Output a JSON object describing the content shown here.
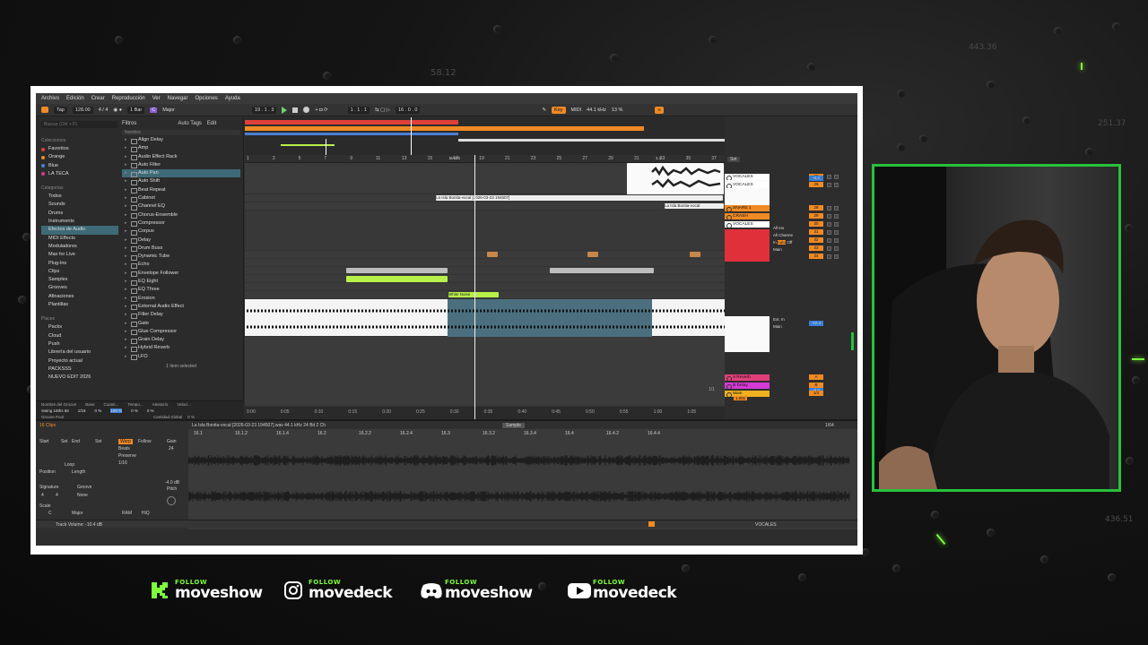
{
  "background_numbers": [
    "58.12",
    "443.36",
    "251.37",
    "436.51"
  ],
  "menu": [
    "Archivo",
    "Edición",
    "Crear",
    "Reproducción",
    "Ver",
    "Navegar",
    "Opciones",
    "Ayuda"
  ],
  "transport": {
    "tap": "Tap",
    "tempo": "128.00",
    "signature": "4 / 4",
    "quant": "1 Bar",
    "key_root": "C",
    "key_scale": "Major",
    "position": "19 . 1 . 3",
    "loop_start": "1 . 1 . 1",
    "loop_length": "16 . 0 . 0",
    "key_label": "Key",
    "midi_label": "MIDI",
    "sample_rate": "44.1 kHz",
    "cpu": "13 %"
  },
  "browser": {
    "search_placeholder": "Buscar (Ctrl + F)",
    "filters_label": "Filtros",
    "autotags_label": "Auto Tags",
    "edit_label": "Edit",
    "name_header": "Nombre",
    "collections_header": "Colecciones",
    "collections": [
      {
        "label": "Favoritos",
        "color": "#e0403a"
      },
      {
        "label": "Orange",
        "color": "#f08a24"
      },
      {
        "label": "Blue",
        "color": "#4a7fd6"
      },
      {
        "label": "LA TECA",
        "color": "#d63a8a"
      }
    ],
    "categories_header": "Categorías",
    "categories": [
      "Todos",
      "Sounds",
      "Drums",
      "Instruments",
      "Efectos de Audio",
      "MIDI Effects",
      "Moduladores",
      "Max for Live",
      "Plug-Ins",
      "Clips",
      "Samples",
      "Grooves",
      "Afinaciones",
      "Plantillas"
    ],
    "places_header": "Places",
    "places": [
      "Packs",
      "Cloud",
      "Push",
      "Librería del usuario",
      "Proyecto actual",
      "PACKSSS",
      "NUEVO EDIT 2026"
    ],
    "devices": [
      "Align Delay",
      "Amp",
      "Audio Effect Rack",
      "Auto Filter",
      "Auto Pan",
      "Auto Shift",
      "Beat Repeat",
      "Cabinet",
      "Channel EQ",
      "Chorus-Ensemble",
      "Compressor",
      "Corpus",
      "Delay",
      "Drum Buss",
      "Dynamic Tube",
      "Echo",
      "Envelope Follower",
      "EQ Eight",
      "EQ Three",
      "Erosion",
      "External Audio Effect",
      "Filter Delay",
      "Gate",
      "Glue Compressor",
      "Grain Delay",
      "Hybrid Reverb",
      "LFO"
    ],
    "selected_info": "1 Item selected",
    "groove_headers": [
      "Nombre del Groove",
      "Base",
      "Cuanti...",
      "Tempo...",
      "Aleatorio",
      "Veloci..."
    ],
    "groove_row": [
      "Swing 16ths 66",
      "1/16",
      "0 %",
      "100 %",
      "0 %",
      "0 %"
    ],
    "groove_pool": "Groove Pool",
    "global_amount": "Cantidad Global",
    "global_value": "0 %"
  },
  "arrangement": {
    "ruler": [
      "1",
      "3",
      "5",
      "7",
      "9",
      "11",
      "13",
      "15",
      "17",
      "19",
      "21",
      "23",
      "25",
      "27",
      "29",
      "31",
      "33",
      "35",
      "37"
    ],
    "locators": [
      "BASS",
      "1.1"
    ],
    "clip_vocal": "La Isla Bonita-vocal [2026-03-23 194507]",
    "clip_vocal_b": "La Isla Bonita-vocal [2026-03-23 194507]",
    "clip_vocal_c": "La Isla Bonita-vocal",
    "clip_white": "White Noise",
    "timeline": [
      "0:00",
      "0:05",
      "0:10",
      "0:15",
      "0:20",
      "0:25",
      "0:30",
      "0:35",
      "0:40",
      "0:45",
      "0:50",
      "0:55",
      "1:00",
      "1:05"
    ],
    "page": "1/1"
  },
  "mixer": {
    "set_label": "Set",
    "tracks": [
      {
        "name": "VOCALES",
        "color": "#ffffff",
        "vol": "25"
      },
      {
        "name": "VOCALES",
        "color": "#ffffff",
        "vol": "26"
      },
      {
        "name": "27 FX chain",
        "color": "#e0403a",
        "vol": ""
      },
      {
        "name": "SNARE 1",
        "color": "#f08a24",
        "vol": "28"
      },
      {
        "name": "CRASH",
        "color": "#f08a24",
        "vol": "29"
      },
      {
        "name": "VOCALES",
        "color": "#ffffff",
        "vol": "30"
      },
      {
        "name": "31 Operator",
        "color": "#b8f04a",
        "vol": "31"
      },
      {
        "name": "32 Crash 909 B",
        "color": "#b8f04a",
        "vol": "32"
      },
      {
        "name": "33 WhiteNoise",
        "color": "#b8f04a",
        "vol": "33"
      },
      {
        "name": "VOCALES",
        "color": "#ffffff",
        "vol": "34"
      }
    ],
    "returns": [
      {
        "name": "A Reverb",
        "color": "#e0407a",
        "vol": "A"
      },
      {
        "name": "B Delay",
        "color": "#d63ad6",
        "vol": "B"
      },
      {
        "name": "Main",
        "color": "#f0b020",
        "vol": "1/2"
      }
    ],
    "io": {
      "all_ins": "All Ins",
      "all_channels": "All Channe",
      "in": "In",
      "auto": "Auto",
      "off": "Off",
      "main": "Main",
      "ext_in": "Ext. In",
      "vol1": "-6.4",
      "vol2": "-10.4",
      "vol3": "-8.0",
      "zoom": "1.00x"
    }
  },
  "detail": {
    "clip_header": "16 Clips",
    "clip_name": "La Isla Bonita-vocal [2026-03-23 194507].wav 44.1 kHz 24 Bit 2 Ch",
    "sample_tab": "Sample",
    "page": "1/64",
    "start": "Start",
    "end": "End",
    "set": "Set",
    "loop": "Loop",
    "position": "Position",
    "length": "Length",
    "signature": "Signature",
    "sig_num": "4",
    "sig_den": "4",
    "groove": "Groove",
    "groove_val": "None",
    "scale": "Scale",
    "scale_root": "C",
    "scale_mode": "Major",
    "warp": "Warp",
    "follow": "Follow",
    "beats": "Beats",
    "preserve": "Preserve",
    "preserve_val": "1/16",
    "gain": "Gain",
    "gain_val": "24",
    "pitch": "Pitch",
    "pitch_val": "-4.0 dB",
    "ram": "RAM",
    "hiq": "HiQ",
    "ruler": [
      "16.1",
      "16.1.2",
      "16.1.4",
      "16.2",
      "16.2.2",
      "16.2.4",
      "16.3",
      "16.3.2",
      "16.3.4",
      "16.4",
      "16.4.2",
      "16.4.4"
    ],
    "status": "Track Volume: -10.4 dB",
    "status_right": "VOCALES"
  },
  "socials": [
    {
      "platform": "kick",
      "follow": "FOLLOW",
      "name": "moveshow",
      "icon": "kick-icon"
    },
    {
      "platform": "instagram",
      "follow": "FOLLOW",
      "name": "movedeck",
      "icon": "instagram-icon"
    },
    {
      "platform": "discord",
      "follow": "FOLLOW",
      "name": "moveshow",
      "icon": "discord-icon"
    },
    {
      "platform": "youtube",
      "follow": "FOLLOW",
      "name": "movedeck",
      "icon": "youtube-icon"
    }
  ],
  "accent": "#7dff3a"
}
